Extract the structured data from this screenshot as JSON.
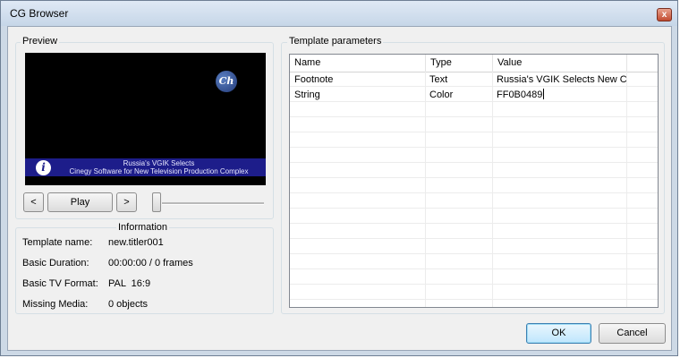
{
  "window": {
    "title": "CG Browser",
    "close_glyph": "x"
  },
  "preview": {
    "group_label": "Preview",
    "logo_text": "Ch",
    "info_logo_text": "i",
    "caption_line1": "Russia's VGIK Selects",
    "caption_line2": "Cinegy Software for New Television Production Complex",
    "prev_label": "<",
    "play_label": "Play",
    "next_label": ">",
    "slider_position": 0
  },
  "information": {
    "group_label": "Information",
    "rows": [
      {
        "label": "Template name:",
        "value": "new.titler001"
      },
      {
        "label": "Basic Duration:",
        "value": "00:00:00 / 0 frames"
      },
      {
        "label": "Basic TV Format:",
        "value": "PAL  16:9"
      },
      {
        "label": "Missing Media:",
        "value": "0 objects"
      }
    ]
  },
  "parameters": {
    "group_label": "Template parameters",
    "columns": [
      "Name",
      "Type",
      "Value"
    ],
    "rows": [
      {
        "name": "Footnote",
        "type": "Text",
        "value": "Russia's VGIK Selects New Cin"
      },
      {
        "name": "String",
        "type": "Color",
        "value": "FF0B0489"
      }
    ]
  },
  "buttons": {
    "ok": "OK",
    "cancel": "Cancel"
  }
}
